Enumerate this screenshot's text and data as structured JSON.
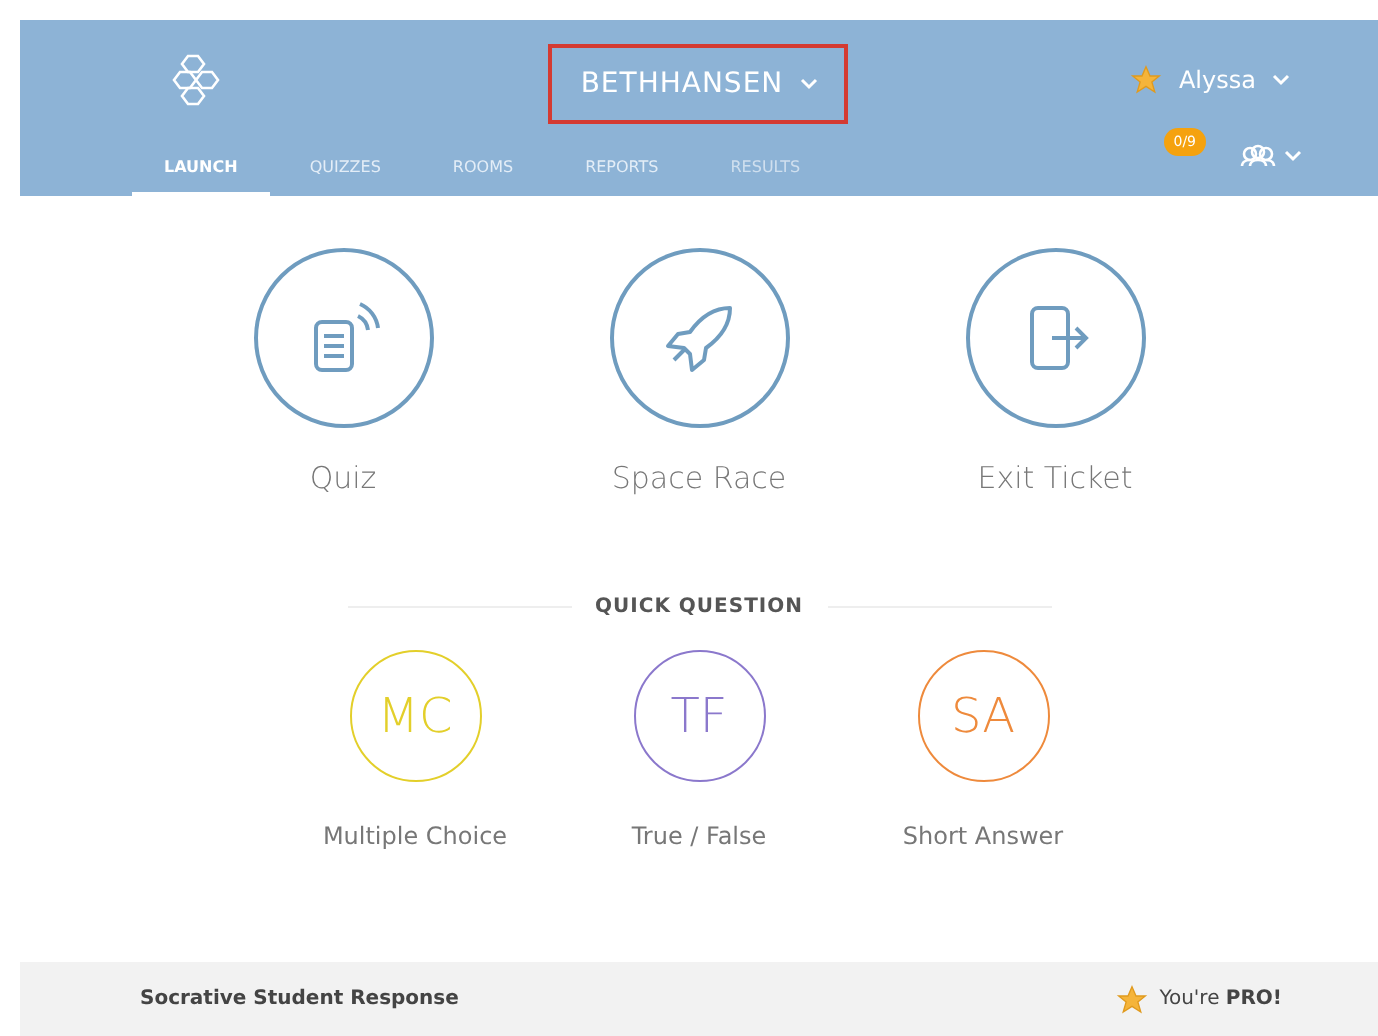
{
  "header": {
    "room": "BETHHANSEN",
    "user": "Alyssa",
    "badge": "0/9"
  },
  "tabs": [
    {
      "label": "LAUNCH",
      "selected": true,
      "disabled": false
    },
    {
      "label": "QUIZZES",
      "selected": false,
      "disabled": false
    },
    {
      "label": "ROOMS",
      "selected": false,
      "disabled": false
    },
    {
      "label": "REPORTS",
      "selected": false,
      "disabled": false
    },
    {
      "label": "RESULTS",
      "selected": false,
      "disabled": true
    }
  ],
  "launch": [
    {
      "kind": "quiz",
      "label": "Quiz"
    },
    {
      "kind": "rocket",
      "label": "Space Race"
    },
    {
      "kind": "exit",
      "label": "Exit Ticket"
    }
  ],
  "quick_question": {
    "title": "QUICK QUESTION",
    "options": [
      {
        "abbr": "MC",
        "label": "Multiple Choice",
        "color": "#e3cf2a"
      },
      {
        "abbr": "TF",
        "label": "True / False",
        "color": "#8b78cc"
      },
      {
        "abbr": "SA",
        "label": "Short Answer",
        "color": "#ee8a3c"
      }
    ]
  },
  "footer": {
    "title": "Socrative Student Response",
    "pro": "You're **PRO!**"
  }
}
